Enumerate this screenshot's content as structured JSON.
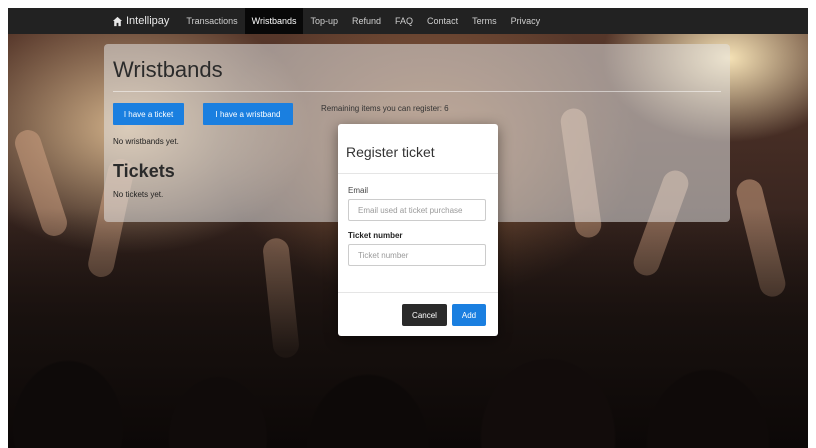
{
  "navbar": {
    "brand": "Intellipay",
    "brand_icon": "home-icon",
    "items": [
      {
        "label": "Transactions",
        "active": false
      },
      {
        "label": "Wristbands",
        "active": true
      },
      {
        "label": "Top-up",
        "active": false
      },
      {
        "label": "Refund",
        "active": false
      },
      {
        "label": "FAQ",
        "active": false
      },
      {
        "label": "Contact",
        "active": false
      },
      {
        "label": "Terms",
        "active": false
      },
      {
        "label": "Privacy",
        "active": false
      }
    ]
  },
  "main": {
    "title": "Wristbands",
    "have_ticket_label": "I have a ticket",
    "have_wristband_label": "I have a wristband",
    "remaining_text": "Remaining items you can register: 6",
    "no_wristbands_text": "No wristbands yet.",
    "tickets_title": "Tickets",
    "no_tickets_text": "No tickets yet."
  },
  "modal": {
    "title": "Register ticket",
    "email_label": "Email",
    "email_value": "",
    "email_placeholder": "Email used at ticket purchase",
    "ticket_label": "Ticket number",
    "ticket_value": "",
    "ticket_placeholder": "Ticket number",
    "cancel_label": "Cancel",
    "add_label": "Add"
  },
  "colors": {
    "primary": "#1a7fe0",
    "navbar": "#222222",
    "cancel": "#2a2a2a"
  }
}
